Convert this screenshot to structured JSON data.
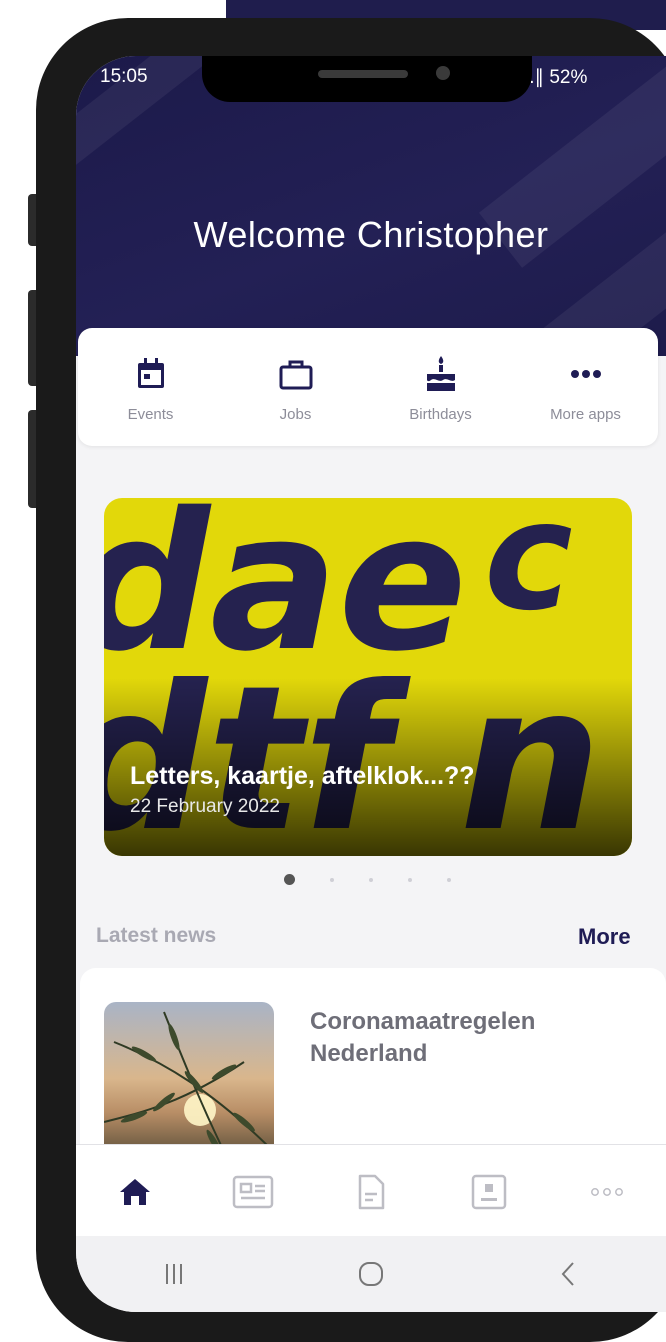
{
  "status_bar": {
    "time": "15:05",
    "signal_battery": "̸ .∥ 52%"
  },
  "header": {
    "welcome": "Welcome Christopher",
    "background_color": "#1f1d4d"
  },
  "quick_apps": [
    {
      "label": "Events",
      "icon": "calendar-icon"
    },
    {
      "label": "Jobs",
      "icon": "briefcase-icon"
    },
    {
      "label": "Birthdays",
      "icon": "cake-icon"
    },
    {
      "label": "More apps",
      "icon": "more-dots-icon"
    }
  ],
  "carousel": {
    "title": "Letters, kaartje, aftelklok...??",
    "date": "22 February 2022",
    "slides_count": 5,
    "active_slide": 1
  },
  "news": {
    "heading": "Latest news",
    "more_label": "More",
    "items": [
      {
        "title": "Coronamaatregelen Nederland"
      }
    ]
  },
  "tab_bar": [
    {
      "icon": "home-icon",
      "active": true
    },
    {
      "icon": "newspaper-icon",
      "active": false
    },
    {
      "icon": "document-icon",
      "active": false
    },
    {
      "icon": "contact-card-icon",
      "active": false
    },
    {
      "icon": "more-dots-icon",
      "active": false
    }
  ],
  "system_nav": [
    {
      "icon": "recent-apps-icon"
    },
    {
      "icon": "home-circle-icon"
    },
    {
      "icon": "back-chevron-icon"
    }
  ],
  "colors": {
    "accent": "#1f1c55",
    "header": "#1f1d4d",
    "highlight_yellow": "#e2d80a"
  }
}
